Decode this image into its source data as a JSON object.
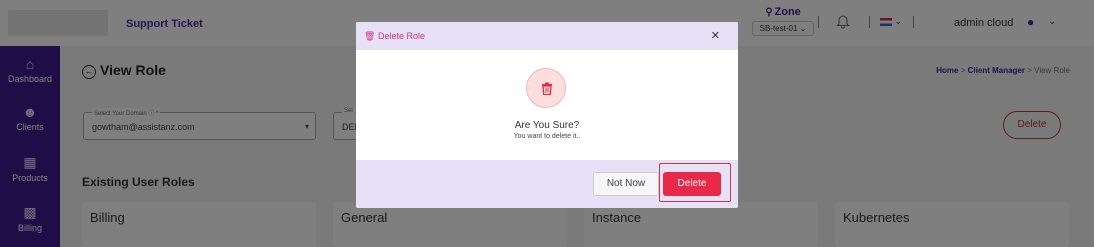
{
  "topbar": {
    "support_label": "Support Ticket",
    "zone_label": "Zone",
    "zone_value": "SB-test-01",
    "username": "admin cloud"
  },
  "sidebar": {
    "items": [
      {
        "label": "Dashboard",
        "icon": "home-icon"
      },
      {
        "label": "Clients",
        "icon": "users-icon"
      },
      {
        "label": "Products",
        "icon": "grid-icon"
      },
      {
        "label": "Billing",
        "icon": "wallet-icon"
      }
    ]
  },
  "page": {
    "title": "View Role",
    "breadcrumb": [
      "Home",
      "Client Manager",
      "View Role"
    ]
  },
  "filters": {
    "domain_label": "Select Your Domain ⓘ *",
    "domain_value": "gowtham@assistanz.com",
    "second_label": "Sel",
    "second_value": "DEM"
  },
  "actions": {
    "delete_outline_label": "Delete"
  },
  "section": {
    "title": "Existing User Roles"
  },
  "role_cards": [
    "Billing",
    "General",
    "Instance",
    "Kubernetes"
  ],
  "modal": {
    "title": "Delete Role",
    "message": "Are You Sure?",
    "submessage": "You want to delete it..",
    "not_now_label": "Not Now",
    "delete_label": "Delete"
  },
  "colors": {
    "sidebar": "#3d1a8c",
    "accent": "#4b2aa8",
    "danger": "#e8294a",
    "modal_header": "#e6e1f6"
  }
}
